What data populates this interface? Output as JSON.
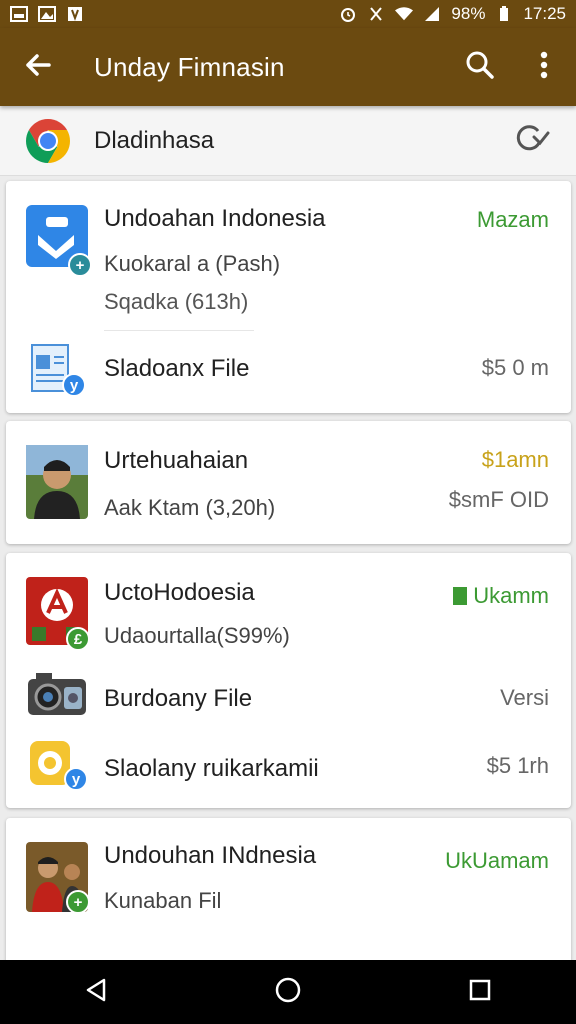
{
  "status_bar": {
    "battery": "98%",
    "time": "17:25"
  },
  "app_bar": {
    "title": "Unday Fimnasin"
  },
  "browser": {
    "name": "Dladinhasa"
  },
  "cards": [
    {
      "rows": [
        {
          "title": "Undoahan Indonesia",
          "subtitle": "Kuokaral a (Pash)",
          "detail": "Sqadka (613h)",
          "right": "Mazam",
          "right_color": "#3c9a33"
        },
        {
          "title": "Sladoanx File",
          "right": "$5 0 m",
          "right_color": "#666666"
        }
      ]
    },
    {
      "rows": [
        {
          "title": "Urtehuahaian",
          "subtitle": "Aak Ktam (3,20h)",
          "right": "$1amn",
          "right_color": "#c8a21a",
          "right2": "$smF OID"
        }
      ]
    },
    {
      "rows": [
        {
          "title": "UctoHodoesia",
          "subtitle": "Udaourtalla(S99%)",
          "right": "Ukamm",
          "right_color": "#3c9a33"
        },
        {
          "title": "Burdoany File",
          "right": "Versi",
          "right_color": "#666666"
        },
        {
          "title": "Slaolany ruikarkamii",
          "right": "$5 1rh",
          "right_color": "#666666"
        }
      ]
    },
    {
      "rows": [
        {
          "title": "Undouhan INdnesia",
          "subtitle": "Kunaban Fil",
          "right": "UkUamam",
          "right_color": "#3c9a33"
        }
      ]
    }
  ],
  "icons": {
    "back": "arrow-left-icon",
    "search": "search-icon",
    "more": "more-vert-icon",
    "refresh": "refresh-icon",
    "nav_back": "triangle-back-icon",
    "nav_home": "circle-home-icon",
    "nav_recent": "square-recent-icon"
  }
}
